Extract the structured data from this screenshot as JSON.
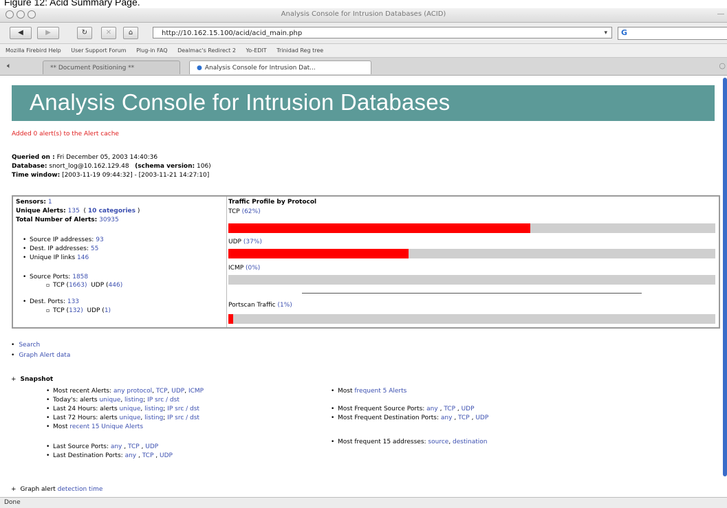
{
  "caption": "Figure 12: Acid Summary Page.",
  "window": {
    "title": "Analysis Console for Intrusion Databases (ACID)"
  },
  "toolbar": {
    "back": "◀",
    "forward": "▶",
    "reload": "↻",
    "stop": "✕",
    "home": "⌂",
    "url": "http://10.162.15.100/acid/acid_main.php",
    "url_dropdown": "▾",
    "search_engine_icon": "G"
  },
  "bookmarks": [
    "Mozilla Firebird Help",
    "User Support Forum",
    "Plug-in FAQ",
    "Dealmac's Redirect 2",
    "Yo-EDIT",
    "Trinidad Reg tree"
  ],
  "tabs": [
    {
      "label": "** Document Positioning **"
    },
    {
      "label": "Analysis Console for Intrusion Dat..."
    }
  ],
  "page": {
    "banner_title": "Analysis Console for Intrusion Databases",
    "added_msg": "Added 0 alert(s) to the Alert cache",
    "queried_label": "Queried on :",
    "queried_value": "Fri December 05, 2003 14:40:36",
    "database_label": "Database:",
    "database_value": "snort_log@10.162.129.48",
    "schema_label": "(schema version:",
    "schema_value": "106)",
    "time_label": "Time window:",
    "time_value": "[2003-11-19 09:44:32] - [2003-11-21 14:27:10]"
  },
  "stats": {
    "sensors_label": "Sensors:",
    "sensors_value": "1",
    "unique_label": "Unique Alerts:",
    "unique_value": "135",
    "categories_value": "10 categories",
    "total_label": "Total Number of Alerts:",
    "total_value": "30935",
    "src_ip_label": "Source IP addresses:",
    "src_ip_value": "93",
    "dst_ip_label": "Dest. IP addresses:",
    "dst_ip_value": "55",
    "unique_links_label": "Unique IP links",
    "unique_links_value": "146",
    "src_ports_label": "Source Ports:",
    "src_ports_value": "1858",
    "src_tcp_label": "TCP (",
    "src_tcp_value": "1663)",
    "src_udp_label": "UDP (",
    "src_udp_value": "446)",
    "dst_ports_label": "Dest. Ports:",
    "dst_ports_value": "133",
    "dst_tcp_label": "TCP (",
    "dst_tcp_value": "132)",
    "dst_udp_label": "UDP (",
    "dst_udp_value": "1)"
  },
  "traffic": {
    "title": "Traffic Profile by Protocol",
    "tcp_label": "TCP",
    "tcp_pct_text": "(62%)",
    "tcp_pct": 62,
    "udp_label": "UDP",
    "udp_pct_text": "(37%)",
    "udp_pct": 37,
    "icmp_label": "ICMP",
    "icmp_pct_text": "(0%)",
    "icmp_pct": 0,
    "portscan_label": "Portscan Traffic",
    "portscan_pct_text": "(1%)",
    "portscan_pct": 1,
    "bar_color": "#ff0000",
    "bar_bg_color": "#cfcfcf"
  },
  "links": {
    "search": "Search",
    "graph_alert": "Graph Alert data",
    "snapshot": "Snapshot",
    "recent_label": "Most recent Alerts:",
    "recent_any": "any protocol",
    "recent_tcp": "TCP",
    "recent_udp": "UDP",
    "recent_icmp": "ICMP",
    "today_label": "Today's: alerts",
    "today_unique": "unique",
    "today_listing": "listing",
    "today_ip": "IP src / dst",
    "last24_label": "Last 24 Hours: alerts",
    "last24_unique": "unique",
    "last24_listing": "listing",
    "last24_ip": "IP src / dst",
    "last72_label": "Last 72 Hours: alerts",
    "last72_unique": "unique",
    "last72_listing": "listing",
    "last72_ip": "IP src / dst",
    "most_label": "Most",
    "most_recent_unique": "recent 15 Unique Alerts",
    "last_src_label": "Last Source Ports:",
    "last_src_any": "any",
    "last_src_tcp": "TCP",
    "last_src_udp": "UDP",
    "last_dst_label": "Last Destination Ports:",
    "last_dst_any": "any",
    "last_dst_tcp": "TCP",
    "last_dst_udp": "UDP",
    "freq5_label": "Most",
    "freq5_link": "frequent 5 Alerts",
    "freq_src_label": "Most Frequent Source Ports:",
    "freq_src_any": "any",
    "freq_src_tcp": "TCP",
    "freq_src_udp": "UDP",
    "freq_dst_label": "Most Frequent Destination Ports:",
    "freq_dst_any": "any",
    "freq_dst_tcp": "TCP",
    "freq_dst_udp": "UDP",
    "freq15_label": "Most frequent 15 addresses:",
    "freq15_src": "source",
    "freq15_dst": "destination",
    "graph_detection_label": "Graph alert",
    "graph_detection_link": "detection time"
  },
  "status_text": "Done"
}
